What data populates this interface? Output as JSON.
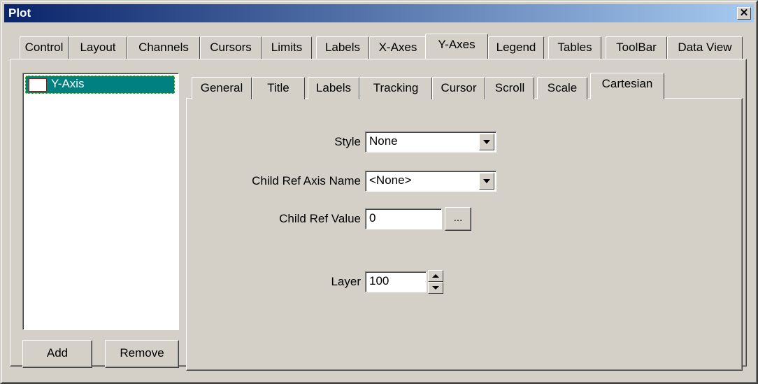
{
  "window": {
    "title": "Plot",
    "close_glyph": "✕"
  },
  "main_tabs": [
    {
      "label": "Control"
    },
    {
      "label": "Layout"
    },
    {
      "label": "Channels"
    },
    {
      "label": "Cursors"
    },
    {
      "label": "Limits"
    },
    {
      "label": "Labels"
    },
    {
      "label": "X-Axes"
    },
    {
      "label": "Y-Axes",
      "active": true
    },
    {
      "label": "Legend"
    },
    {
      "label": "Tables"
    },
    {
      "label": "ToolBar"
    },
    {
      "label": "Data View"
    }
  ],
  "axis_list": {
    "items": [
      {
        "label": "Y-Axis",
        "selected": true
      }
    ],
    "add_label": "Add",
    "remove_label": "Remove"
  },
  "sub_tabs": [
    {
      "label": "General"
    },
    {
      "label": "Title"
    },
    {
      "label": "Labels"
    },
    {
      "label": "Tracking"
    },
    {
      "label": "Cursor"
    },
    {
      "label": "Scroll"
    },
    {
      "label": "Scale"
    },
    {
      "label": "Cartesian",
      "active": true
    }
  ],
  "cartesian": {
    "style_label": "Style",
    "style_value": "None",
    "child_ref_axis_label": "Child Ref Axis Name",
    "child_ref_axis_value": "<None>",
    "child_ref_value_label": "Child Ref Value",
    "child_ref_value": "0",
    "ellipsis_label": "...",
    "layer_label": "Layer",
    "layer_value": "100"
  }
}
